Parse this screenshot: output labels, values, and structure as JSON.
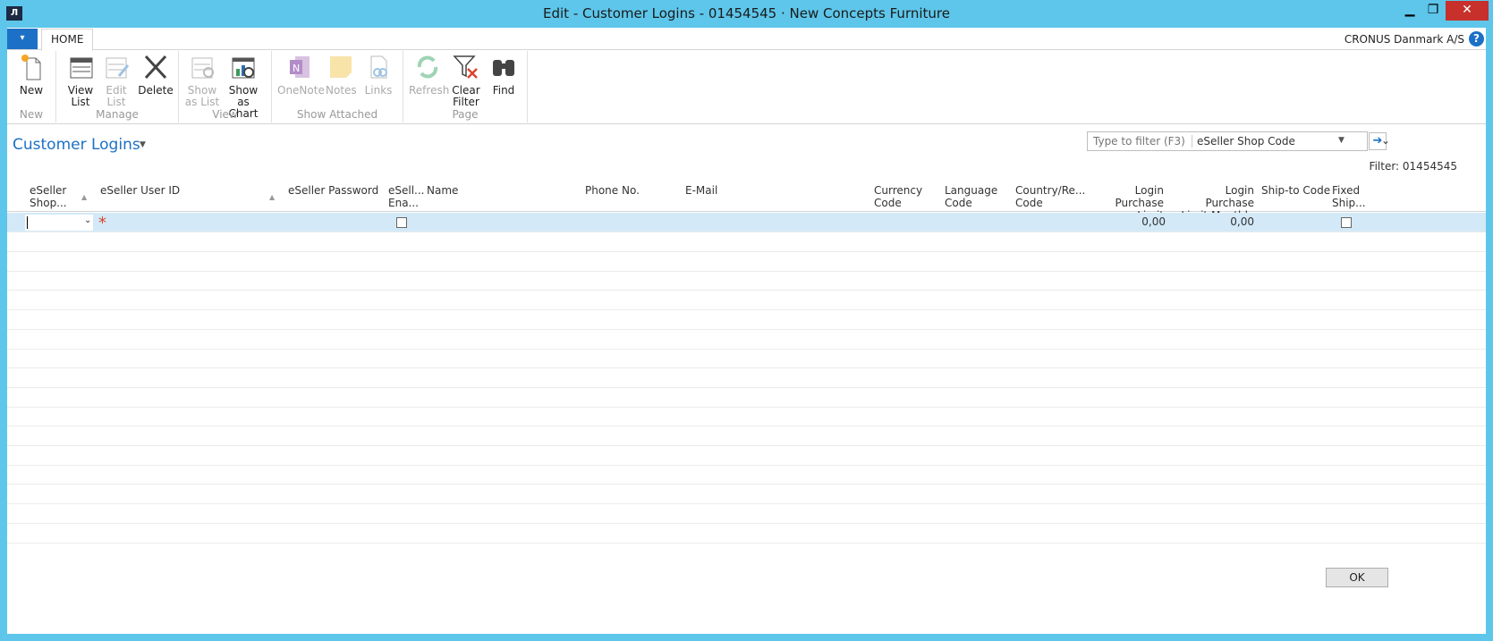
{
  "window": {
    "title": "Edit - Customer Logins - 01454545 · New Concepts Furniture",
    "app_icon": "dynamics-nav-icon",
    "minimize": "▁",
    "maximize": "❐",
    "close": "✕"
  },
  "tabbar": {
    "menu_icon": "▾",
    "home_tab": "HOME",
    "company": "CRONUS Danmark A/S",
    "help": "?"
  },
  "ribbon": {
    "groups": [
      {
        "label": "New",
        "buttons": [
          {
            "label": "New",
            "icon": "new-document-icon",
            "enabled": true
          }
        ]
      },
      {
        "label": "Manage",
        "buttons": [
          {
            "label": "View List",
            "icon": "view-list-icon",
            "enabled": true
          },
          {
            "label": "Edit List",
            "icon": "edit-list-icon",
            "enabled": false
          },
          {
            "label": "Delete",
            "icon": "delete-icon",
            "enabled": true
          }
        ]
      },
      {
        "label": "View",
        "buttons": [
          {
            "label": "Show as List",
            "icon": "show-as-list-icon",
            "enabled": false
          },
          {
            "label": "Show as Chart",
            "icon": "show-as-chart-icon",
            "enabled": true
          }
        ]
      },
      {
        "label": "Show Attached",
        "buttons": [
          {
            "label": "OneNote",
            "icon": "onenote-icon",
            "enabled": false
          },
          {
            "label": "Notes",
            "icon": "notes-icon",
            "enabled": false
          },
          {
            "label": "Links",
            "icon": "links-icon",
            "enabled": false
          }
        ]
      },
      {
        "label": "Page",
        "buttons": [
          {
            "label": "Refresh",
            "icon": "refresh-icon",
            "enabled": false
          },
          {
            "label": "Clear Filter",
            "icon": "clear-filter-icon",
            "enabled": true
          },
          {
            "label": "Find",
            "icon": "find-binoculars-icon",
            "enabled": true
          }
        ]
      }
    ]
  },
  "page": {
    "title": "Customer Logins",
    "filter_placeholder": "Type to filter (F3)",
    "filter_field": "eSeller Shop Code",
    "filter_status": "Filter: 01454545",
    "colors": {
      "accent": "#1c70c6",
      "titlebar": "#5ec6ea",
      "selected_row": "#d3e9f8",
      "required": "#d9452e"
    }
  },
  "grid": {
    "columns": [
      {
        "line1": "eSeller",
        "line2": "Shop..."
      },
      {
        "line1": "eSeller User ID",
        "line2": ""
      },
      {
        "line1": "eSeller Password",
        "line2": ""
      },
      {
        "line1": "eSell...",
        "line2": "Ena..."
      },
      {
        "line1": "Name",
        "line2": ""
      },
      {
        "line1": "Phone No.",
        "line2": ""
      },
      {
        "line1": "E-Mail",
        "line2": ""
      },
      {
        "line1": "Currency",
        "line2": "Code"
      },
      {
        "line1": "Language",
        "line2": "Code"
      },
      {
        "line1": "Country/Re...",
        "line2": "Code"
      },
      {
        "line1": "Login Purchase",
        "line2": "Limit"
      },
      {
        "line1": "Login Purchase",
        "line2": "Limit Monthly"
      },
      {
        "line1": "Ship-to Code",
        "line2": ""
      },
      {
        "line1": "Fixed",
        "line2": "Ship..."
      }
    ],
    "new_row": {
      "login_purchase_limit": "0,00",
      "login_purchase_limit_monthly": "0,00",
      "eseller_enabled": false,
      "fixed_ship": false
    },
    "empty_rows": 16
  },
  "footer": {
    "ok_label": "OK"
  }
}
